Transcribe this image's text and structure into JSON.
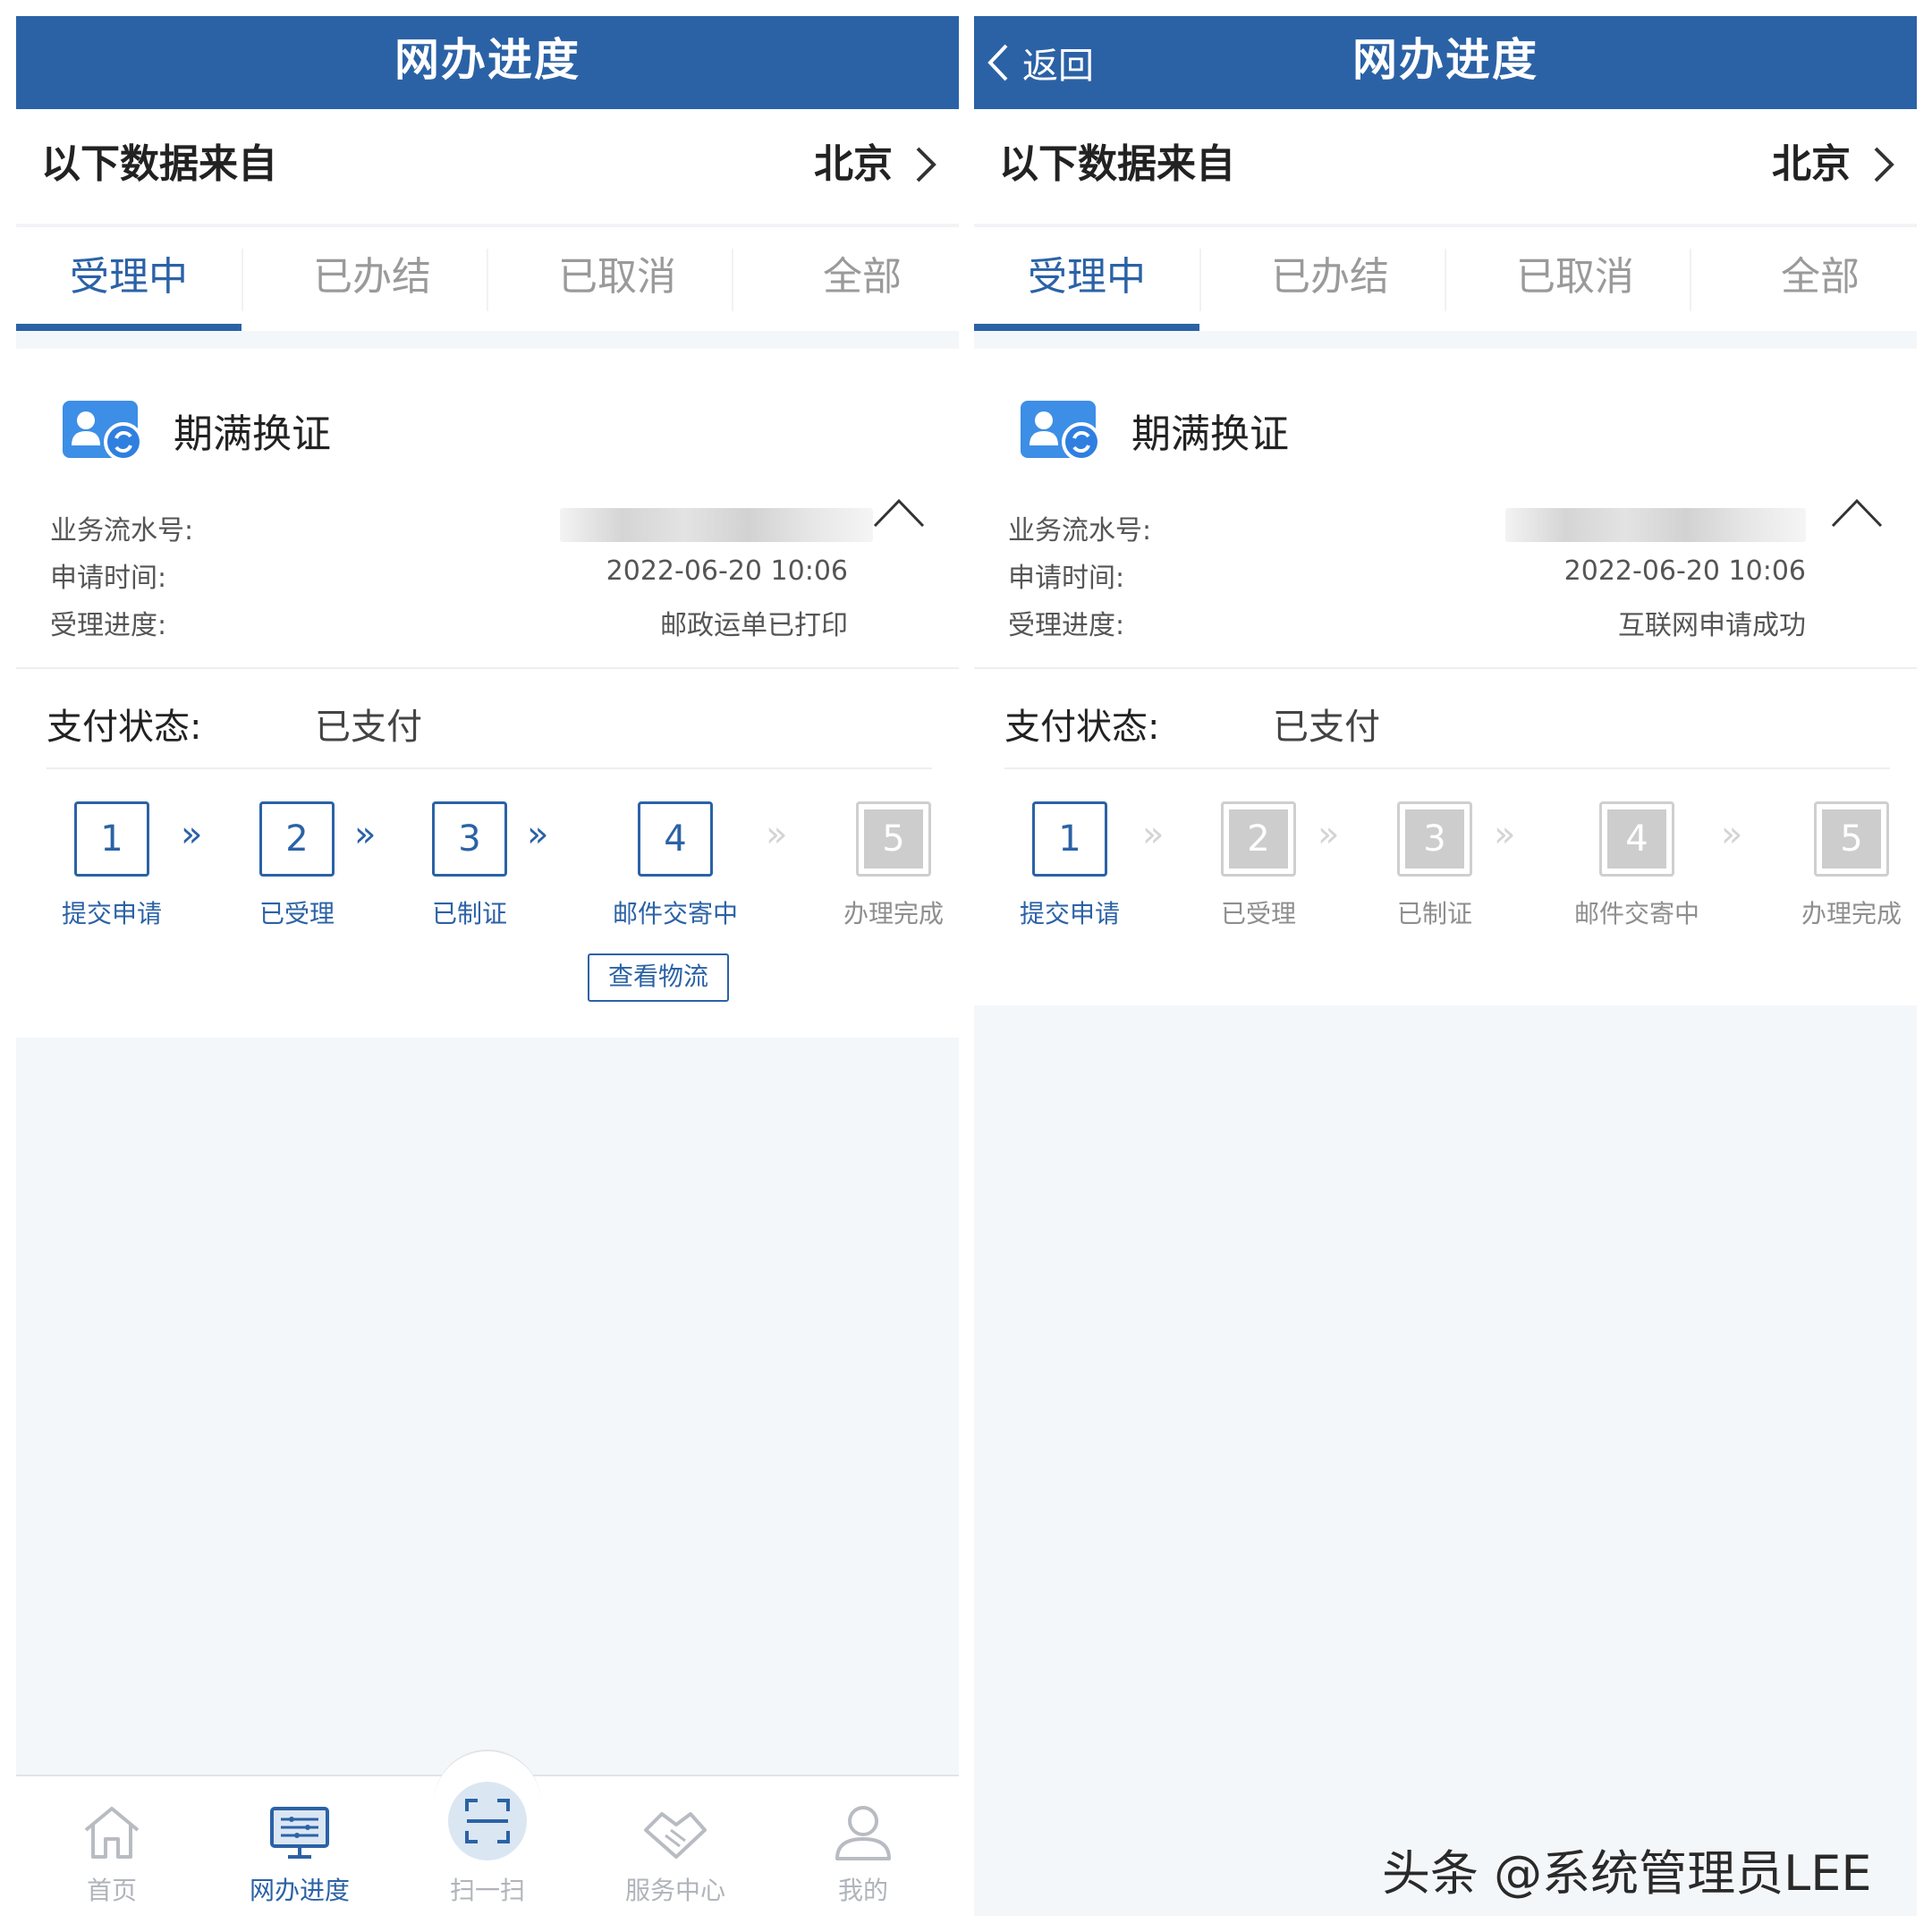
{
  "left": {
    "header": {
      "title": "网办进度"
    },
    "source": {
      "label": "以下数据来自",
      "city": "北京"
    },
    "tabs": [
      {
        "label": "受理中",
        "active": true
      },
      {
        "label": "已办结",
        "active": false
      },
      {
        "label": "已取消",
        "active": false
      },
      {
        "label": "全部",
        "active": false
      }
    ],
    "card": {
      "title": "期满换证",
      "icon": "id-renew-icon",
      "fields": [
        {
          "label": "业务流水号:",
          "value": ""
        },
        {
          "label": "申请时间:",
          "value": "2022-06-20 10:06"
        },
        {
          "label": "受理进度:",
          "value": "邮政运单已打印"
        }
      ],
      "payment": {
        "label": "支付状态:",
        "value": "已支付"
      },
      "steps": [
        {
          "num": "1",
          "label": "提交申请",
          "active": true
        },
        {
          "num": "2",
          "label": "已受理",
          "active": true
        },
        {
          "num": "3",
          "label": "已制证",
          "active": true
        },
        {
          "num": "4",
          "label": "邮件交寄中",
          "active": true
        },
        {
          "num": "5",
          "label": "办理完成",
          "active": false
        }
      ],
      "arrow_glyph": "»",
      "logistics_button": "查看物流"
    },
    "bottom_nav": [
      {
        "label": "首页",
        "icon": "home-icon",
        "active": false
      },
      {
        "label": "网办进度",
        "icon": "progress-monitor-icon",
        "active": true
      },
      {
        "label": "扫一扫",
        "icon": "scan-icon",
        "active": false
      },
      {
        "label": "服务中心",
        "icon": "handshake-icon",
        "active": false
      },
      {
        "label": "我的",
        "icon": "user-icon",
        "active": false
      }
    ]
  },
  "right": {
    "header": {
      "back_label": "返回",
      "title": "网办进度"
    },
    "source": {
      "label": "以下数据来自",
      "city": "北京"
    },
    "tabs": [
      {
        "label": "受理中",
        "active": true
      },
      {
        "label": "已办结",
        "active": false
      },
      {
        "label": "已取消",
        "active": false
      },
      {
        "label": "全部",
        "active": false
      }
    ],
    "card": {
      "title": "期满换证",
      "icon": "id-renew-icon",
      "fields": [
        {
          "label": "业务流水号:",
          "value": ""
        },
        {
          "label": "申请时间:",
          "value": "2022-06-20 10:06"
        },
        {
          "label": "受理进度:",
          "value": "互联网申请成功"
        }
      ],
      "payment": {
        "label": "支付状态:",
        "value": "已支付"
      },
      "steps": [
        {
          "num": "1",
          "label": "提交申请",
          "active": true
        },
        {
          "num": "2",
          "label": "已受理",
          "active": false
        },
        {
          "num": "3",
          "label": "已制证",
          "active": false
        },
        {
          "num": "4",
          "label": "邮件交寄中",
          "active": false
        },
        {
          "num": "5",
          "label": "办理完成",
          "active": false
        }
      ],
      "arrow_glyph": "»"
    }
  },
  "watermark": "头条 @系统管理员LEE",
  "colors": {
    "primary": "#2b62a6",
    "inactive": "#9a9a9a",
    "background": "#f4f7fa"
  }
}
